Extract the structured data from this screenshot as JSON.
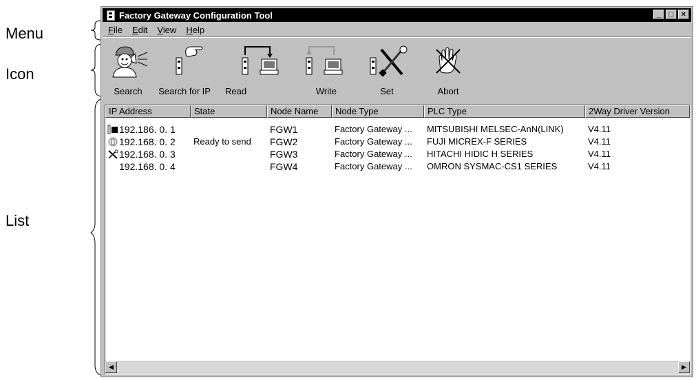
{
  "annotations": {
    "menu": "Menu",
    "icon": "Icon",
    "list": "List"
  },
  "window": {
    "title": "Factory Gateway Configuration Tool",
    "controls": {
      "minimize": "_",
      "maximize": "□",
      "close": "×"
    }
  },
  "menubar": {
    "items": [
      "File",
      "Edit",
      "View",
      "Help"
    ]
  },
  "toolbar": {
    "buttons": [
      {
        "label": "Search",
        "icon": "search-person-icon"
      },
      {
        "label": "Search for IP",
        "icon": "pointing-hand-icon"
      },
      {
        "label": "Read",
        "icon": "read-device-icon"
      },
      {
        "label": "Write",
        "icon": "write-device-icon"
      },
      {
        "label": "Set",
        "icon": "wrench-screwdriver-icon"
      },
      {
        "label": "Abort",
        "icon": "abort-hand-icon"
      }
    ]
  },
  "list": {
    "columns": [
      "IP Address",
      "State",
      "Node Name",
      "Node Type",
      "PLC Type",
      "2Way Driver Version"
    ],
    "rows": [
      {
        "icon": "device-icon",
        "ip": "192.186. 0. 1",
        "state": "",
        "node_name": "FGW1",
        "node_type": "Factory Gateway ...",
        "plc_type": "MITSUBISHI MELSEC-AnN(LINK)",
        "version": "V4.11"
      },
      {
        "icon": "ready-send-icon",
        "ip": "192.168. 0. 2",
        "state": "Ready to send",
        "node_name": "FGW2",
        "node_type": "Factory Gateway ...",
        "plc_type": "FUJI MICREX-F SERIES",
        "version": "V4.11"
      },
      {
        "icon": "tools-icon",
        "ip": "192.168. 0. 3",
        "state": "",
        "node_name": "FGW3",
        "node_type": "Factory Gateway ...",
        "plc_type": "HITACHI HIDIC H SERIES",
        "version": "V4.11"
      },
      {
        "icon": "",
        "ip": "192.168. 0. 4",
        "state": "",
        "node_name": "FGW4",
        "node_type": "Factory Gateway ...",
        "plc_type": "OMRON SYSMAC-CS1 SERIES",
        "version": "V4.11"
      }
    ]
  },
  "scrollbar": {
    "left_arrow": "◀",
    "right_arrow": "▶"
  }
}
